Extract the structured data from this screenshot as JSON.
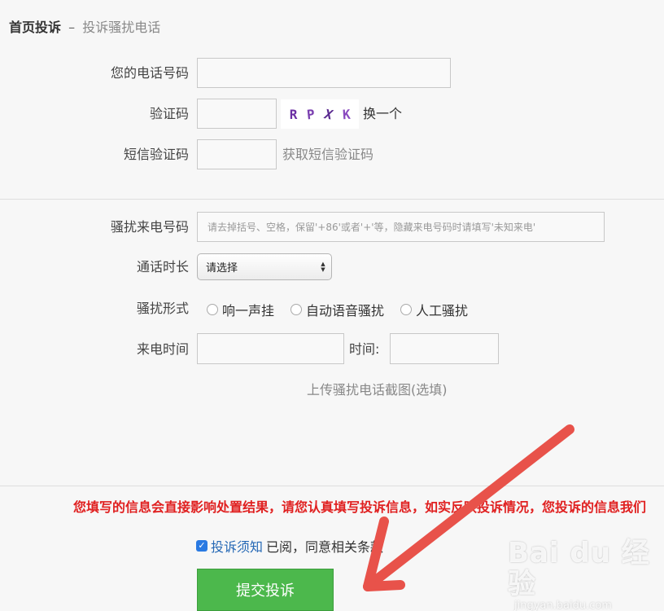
{
  "breadcrumb": {
    "home": "首页投诉",
    "separator": "–",
    "current": "投诉骚扰电话"
  },
  "form": {
    "phone_label": "您的电话号码",
    "phone_value": "",
    "captcha_label": "验证码",
    "captcha_value": "",
    "captcha_chars": [
      "R",
      "P",
      "X",
      "K"
    ],
    "captcha_refresh": "换一个",
    "sms_label": "短信验证码",
    "sms_value": "",
    "sms_get": "获取短信验证码",
    "harass_number_label": "骚扰来电号码",
    "harass_number_placeholder": "请去掉括号、空格，保留'+86'或者'+'等，隐藏来电号码时请填写'未知来电'",
    "duration_label": "通话时长",
    "duration_selected": "请选择",
    "type_label": "骚扰形式",
    "type_options": [
      "响一声挂",
      "自动语音骚扰",
      "人工骚扰"
    ],
    "call_time_label": "来电时间",
    "time_label": "时间:",
    "upload_label": "上传骚扰电话截图(选填)"
  },
  "footer": {
    "warning": "您填写的信息会直接影响处置结果，请您认真填写投诉信息，如实反映投诉情况，您投诉的信息我们",
    "agree_checked": true,
    "notice_link": "投诉须知",
    "agree_text": "已阅，同意相关条款",
    "submit_label": "提交投诉"
  },
  "watermark": {
    "brand": "Bai du 经验",
    "url": "jingyan.baidu.com"
  },
  "colors": {
    "warning": "#e02020",
    "link": "#2568b5",
    "submit": "#4cb84c",
    "arrow": "#e8524a"
  }
}
